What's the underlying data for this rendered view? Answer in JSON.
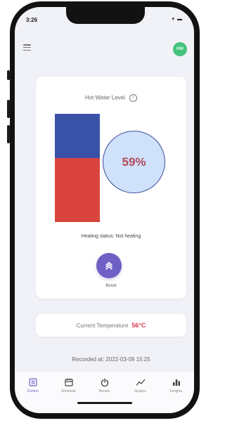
{
  "status_bar": {
    "time": "3:26",
    "icons": "▾ ▬"
  },
  "header": {
    "avatar_initials": "HW"
  },
  "main_card": {
    "title": "Hot Water Level",
    "level_fraction": 0.59,
    "level_display": "59%",
    "heating_status": "Heating status: Not heating",
    "boost_label": "Boost"
  },
  "temperature": {
    "label": "Current Temperature",
    "value": "56°C"
  },
  "recorded_at": "Recorded at: 2022-03-09 15:25",
  "tabs": [
    {
      "label": "Control",
      "icon": "control-icon",
      "active": true
    },
    {
      "label": "Schedule",
      "icon": "calendar-icon",
      "active": false
    },
    {
      "label": "Boosts",
      "icon": "boost-icon",
      "active": false
    },
    {
      "label": "Graphs",
      "icon": "graph-icon",
      "active": false
    },
    {
      "label": "Insights",
      "icon": "insights-icon",
      "active": false
    }
  ],
  "colors": {
    "accent": "#6e60c4",
    "tank_top": "#3a51a8",
    "tank_hot": "#d9453e",
    "temperature": "#d93b4f",
    "avatar": "#46c27e"
  }
}
